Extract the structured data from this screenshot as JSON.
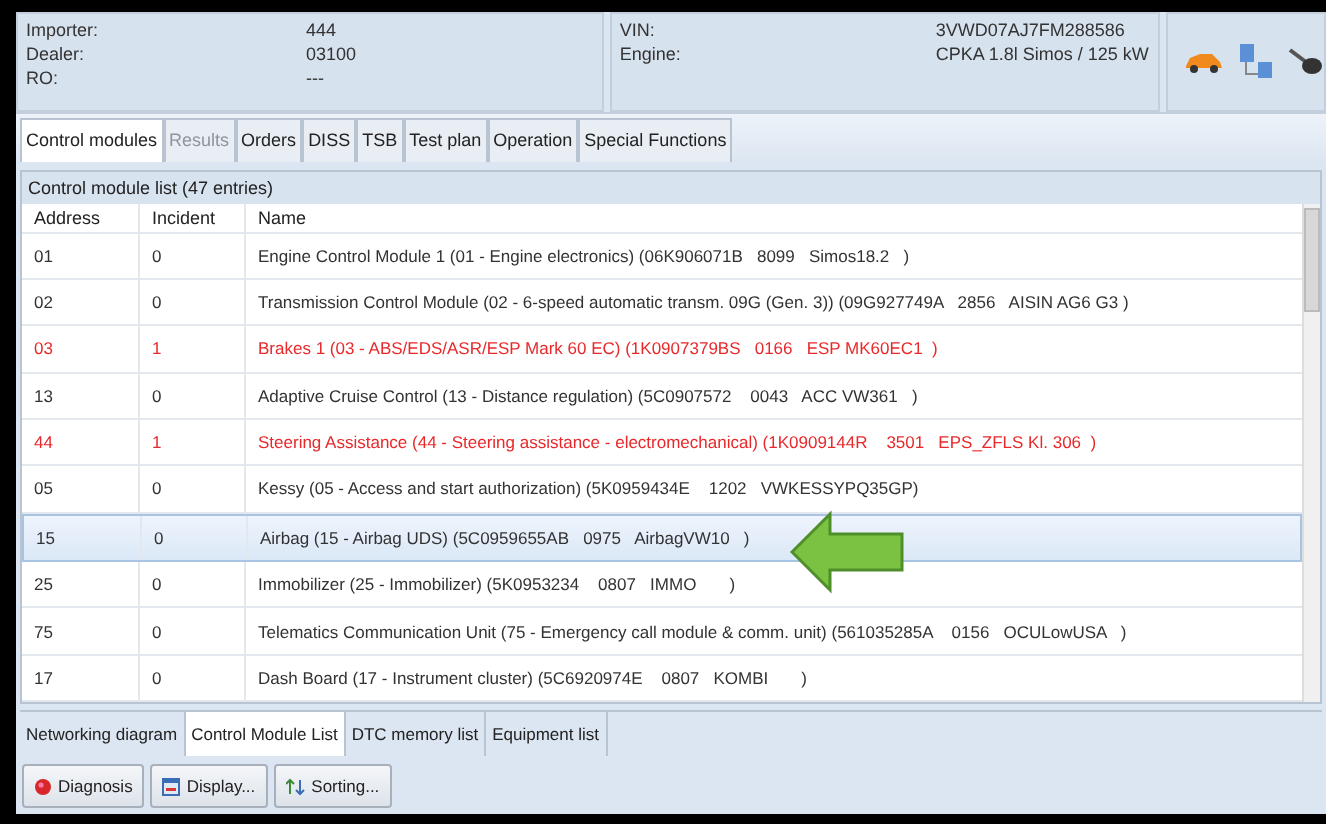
{
  "vehicle_info": [
    {
      "label": "Importer:",
      "value": "444"
    },
    {
      "label": "Dealer:",
      "value": "03100"
    },
    {
      "label": "RO:",
      "value": "---"
    }
  ],
  "vehicle_info_2": [
    {
      "label": "VIN:",
      "value": "3VWD07AJ7FM288586"
    },
    {
      "label": "Engine:",
      "value": "CPKA 1.8l Simos / 125 kW"
    }
  ],
  "tabs": [
    {
      "label": "Control modules",
      "selected": true,
      "disabled": false
    },
    {
      "label": "Results",
      "selected": false,
      "disabled": true
    },
    {
      "label": "Orders",
      "selected": false,
      "disabled": false
    },
    {
      "label": "DISS",
      "selected": false,
      "disabled": false
    },
    {
      "label": "TSB",
      "selected": false,
      "disabled": false
    },
    {
      "label": "Test plan",
      "selected": false,
      "disabled": false
    },
    {
      "label": "Operation",
      "selected": false,
      "disabled": false
    },
    {
      "label": "Special Functions",
      "selected": false,
      "disabled": false
    }
  ],
  "list_title": "Control module list (47 entries)",
  "table": {
    "columns": [
      "Address",
      "Incident",
      "Name"
    ],
    "rows": [
      {
        "address": "01",
        "incident": "0",
        "name": "Engine Control Module 1 (01 - Engine electronics) (06K906071B   8099   Simos18.2   )",
        "fault": false,
        "selected": false
      },
      {
        "address": "02",
        "incident": "0",
        "name": "Transmission Control Module (02 - 6-speed automatic transm. 09G (Gen. 3)) (09G927749A   2856   AISIN AG6 G3 )",
        "fault": false,
        "selected": false
      },
      {
        "address": "03",
        "incident": "1",
        "name": "Brakes 1 (03 - ABS/EDS/ASR/ESP Mark 60 EC) (1K0907379BS   0166   ESP MK60EC1  )",
        "fault": true,
        "selected": false
      },
      {
        "address": "13",
        "incident": "0",
        "name": "Adaptive Cruise Control (13 - Distance regulation) (5C0907572    0043   ACC VW361   )",
        "fault": false,
        "selected": false
      },
      {
        "address": "44",
        "incident": "1",
        "name": "Steering Assistance (44 - Steering assistance - electromechanical) (1K0909144R    3501   EPS_ZFLS Kl. 306  )",
        "fault": true,
        "selected": false
      },
      {
        "address": "05",
        "incident": "0",
        "name": "Kessy (05 - Access and start authorization) (5K0959434E    1202   VWKESSYPQ35GP)",
        "fault": false,
        "selected": false
      },
      {
        "address": "15",
        "incident": "0",
        "name": "Airbag (15 - Airbag UDS) (5C0959655AB   0975   AirbagVW10   )",
        "fault": false,
        "selected": true
      },
      {
        "address": "25",
        "incident": "0",
        "name": "Immobilizer (25 - Immobilizer) (5K0953234    0807   IMMO       )",
        "fault": false,
        "selected": false
      },
      {
        "address": "75",
        "incident": "0",
        "name": "Telematics Communication Unit (75 - Emergency call module & comm. unit) (561035285A    0156   OCULowUSA   )",
        "fault": false,
        "selected": false
      },
      {
        "address": "17",
        "incident": "0",
        "name": "Dash Board (17 - Instrument cluster) (5C6920974E    0807   KOMBI       )",
        "fault": false,
        "selected": false
      }
    ]
  },
  "bottom_tabs": [
    {
      "label": "Networking diagram",
      "selected": false
    },
    {
      "label": "Control Module List",
      "selected": true
    },
    {
      "label": "DTC memory list",
      "selected": false
    },
    {
      "label": "Equipment list",
      "selected": false
    }
  ],
  "buttons": [
    {
      "label": "Diagnosis",
      "kind": "diagnosis"
    },
    {
      "label": "Display...",
      "kind": "display"
    },
    {
      "label": "Sorting...",
      "kind": "sorting"
    }
  ]
}
